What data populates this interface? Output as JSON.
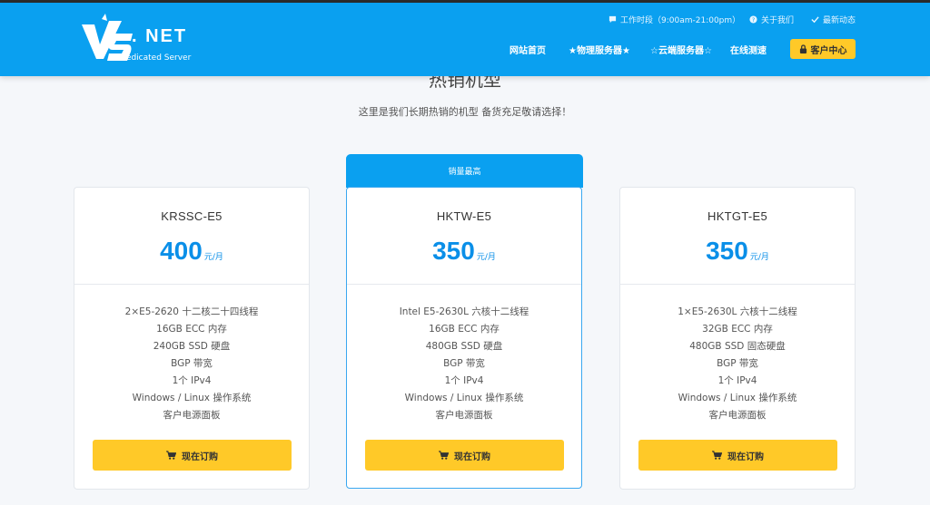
{
  "brand": {
    "net": ". NET",
    "subtitle": "Dedicated Server"
  },
  "utility": {
    "hours": "工作时段（9:00am-21:00pm）",
    "about": "关于我们",
    "news": "最新动态"
  },
  "nav": {
    "home": "网站首页",
    "physical": "★物理服务器★",
    "cloud": "☆云端服务器☆",
    "speedtest": "在线测速",
    "client": "客户中心"
  },
  "section": {
    "title": "热销机型",
    "subtitle": "这里是我们长期热销的机型 备货充足敬请选择！"
  },
  "featured_badge": "销量最高",
  "price_unit": "元/月",
  "buy_label": "现在订购",
  "plans": [
    {
      "name": "KRSSC-E5",
      "price": "400",
      "specs": [
        "2×E5-2620 十二核二十四线程",
        "16GB ECC 内存",
        "240GB SSD 硬盘",
        "BGP 带宽",
        "1个 IPv4",
        "Windows / Linux 操作系统",
        "客户电源面板"
      ]
    },
    {
      "name": "HKTW-E5",
      "price": "350",
      "specs": [
        "Intel E5-2630L 六核十二线程",
        "16GB ECC 内存",
        "480GB SSD 硬盘",
        "BGP 带宽",
        "1个 IPv4",
        "Windows / Linux 操作系统",
        "客户电源面板"
      ]
    },
    {
      "name": "HKTGT-E5",
      "price": "350",
      "specs": [
        "1×E5-2630L 六核十二线程",
        "32GB ECC 内存",
        "480GB SSD 固态硬盘",
        "BGP 带宽",
        "1个 IPv4",
        "Windows / Linux 操作系统",
        "客户电源面板"
      ]
    }
  ],
  "colors": {
    "header": "#0aa0f0",
    "accent": "#ffc928",
    "price": "#0a8fe8"
  }
}
